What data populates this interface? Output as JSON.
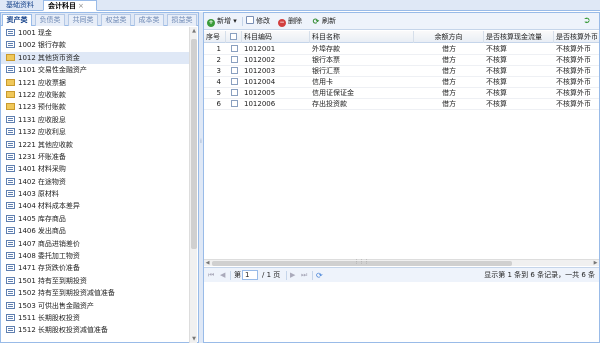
{
  "page_tabs": [
    {
      "label": "基础资料"
    },
    {
      "label": "会计科目",
      "close": "×"
    }
  ],
  "category_tabs": [
    "资产类",
    "负债类",
    "共同类",
    "权益类",
    "成本类",
    "损益类"
  ],
  "tree_items": [
    {
      "code": "1001",
      "name": "现金",
      "type": "leaf"
    },
    {
      "code": "1002",
      "name": "银行存款",
      "type": "leaf"
    },
    {
      "code": "1012",
      "name": "其他货币资金",
      "type": "folder",
      "selected": true
    },
    {
      "code": "1101",
      "name": "交易性金融资产",
      "type": "leaf"
    },
    {
      "code": "1121",
      "name": "应收票据",
      "type": "folder"
    },
    {
      "code": "1122",
      "name": "应收账款",
      "type": "folder"
    },
    {
      "code": "1123",
      "name": "预付账款",
      "type": "folder"
    },
    {
      "code": "1131",
      "name": "应收股息",
      "type": "leaf"
    },
    {
      "code": "1132",
      "name": "应收利息",
      "type": "leaf"
    },
    {
      "code": "1221",
      "name": "其他应收款",
      "type": "leaf"
    },
    {
      "code": "1231",
      "name": "坏账准备",
      "type": "leaf"
    },
    {
      "code": "1401",
      "name": "材料采购",
      "type": "leaf"
    },
    {
      "code": "1402",
      "name": "在途物资",
      "type": "leaf"
    },
    {
      "code": "1403",
      "name": "原材料",
      "type": "leaf"
    },
    {
      "code": "1404",
      "name": "材料成本差异",
      "type": "leaf"
    },
    {
      "code": "1405",
      "name": "库存商品",
      "type": "leaf"
    },
    {
      "code": "1406",
      "name": "发出商品",
      "type": "leaf"
    },
    {
      "code": "1407",
      "name": "商品进销差价",
      "type": "leaf"
    },
    {
      "code": "1408",
      "name": "委托加工物资",
      "type": "leaf"
    },
    {
      "code": "1471",
      "name": "存货跌价准备",
      "type": "leaf"
    },
    {
      "code": "1501",
      "name": "持有至到期投资",
      "type": "leaf"
    },
    {
      "code": "1502",
      "name": "持有至到期投资减值准备",
      "type": "leaf"
    },
    {
      "code": "1503",
      "name": "可供出售金融资产",
      "type": "leaf"
    },
    {
      "code": "1511",
      "name": "长期股权投资",
      "type": "leaf"
    },
    {
      "code": "1512",
      "name": "长期股权投资减值准备",
      "type": "leaf"
    }
  ],
  "toolbar": {
    "add_label": "新增",
    "add_arrow": "▾",
    "edit_label": "修改",
    "delete_label": "删除",
    "refresh_label": "刷新"
  },
  "grid": {
    "columns": [
      "序号",
      "科目编码",
      "科目名称",
      "余额方向",
      "是否核算现金流量",
      "是否核算外币"
    ],
    "rows": [
      {
        "num": "1",
        "code": "1012001",
        "name": "外埠存款",
        "direction": "借方",
        "cash_flow": "不核算",
        "foreign": "不核算外币"
      },
      {
        "num": "2",
        "code": "1012002",
        "name": "银行本票",
        "direction": "借方",
        "cash_flow": "不核算",
        "foreign": "不核算外币"
      },
      {
        "num": "3",
        "code": "1012003",
        "name": "银行汇票",
        "direction": "借方",
        "cash_flow": "不核算",
        "foreign": "不核算外币"
      },
      {
        "num": "4",
        "code": "1012004",
        "name": "信用卡",
        "direction": "借方",
        "cash_flow": "不核算",
        "foreign": "不核算外币"
      },
      {
        "num": "5",
        "code": "1012005",
        "name": "信用证保证金",
        "direction": "借方",
        "cash_flow": "不核算",
        "foreign": "不核算外币"
      },
      {
        "num": "6",
        "code": "1012006",
        "name": "存出投资款",
        "direction": "借方",
        "cash_flow": "不核算",
        "foreign": "不核算外币"
      }
    ]
  },
  "pager": {
    "page_label": "第",
    "page_value": "1",
    "total_label": "/ 1 页",
    "info": "显示第 1 条到 6 条记录，一共 6 条"
  }
}
